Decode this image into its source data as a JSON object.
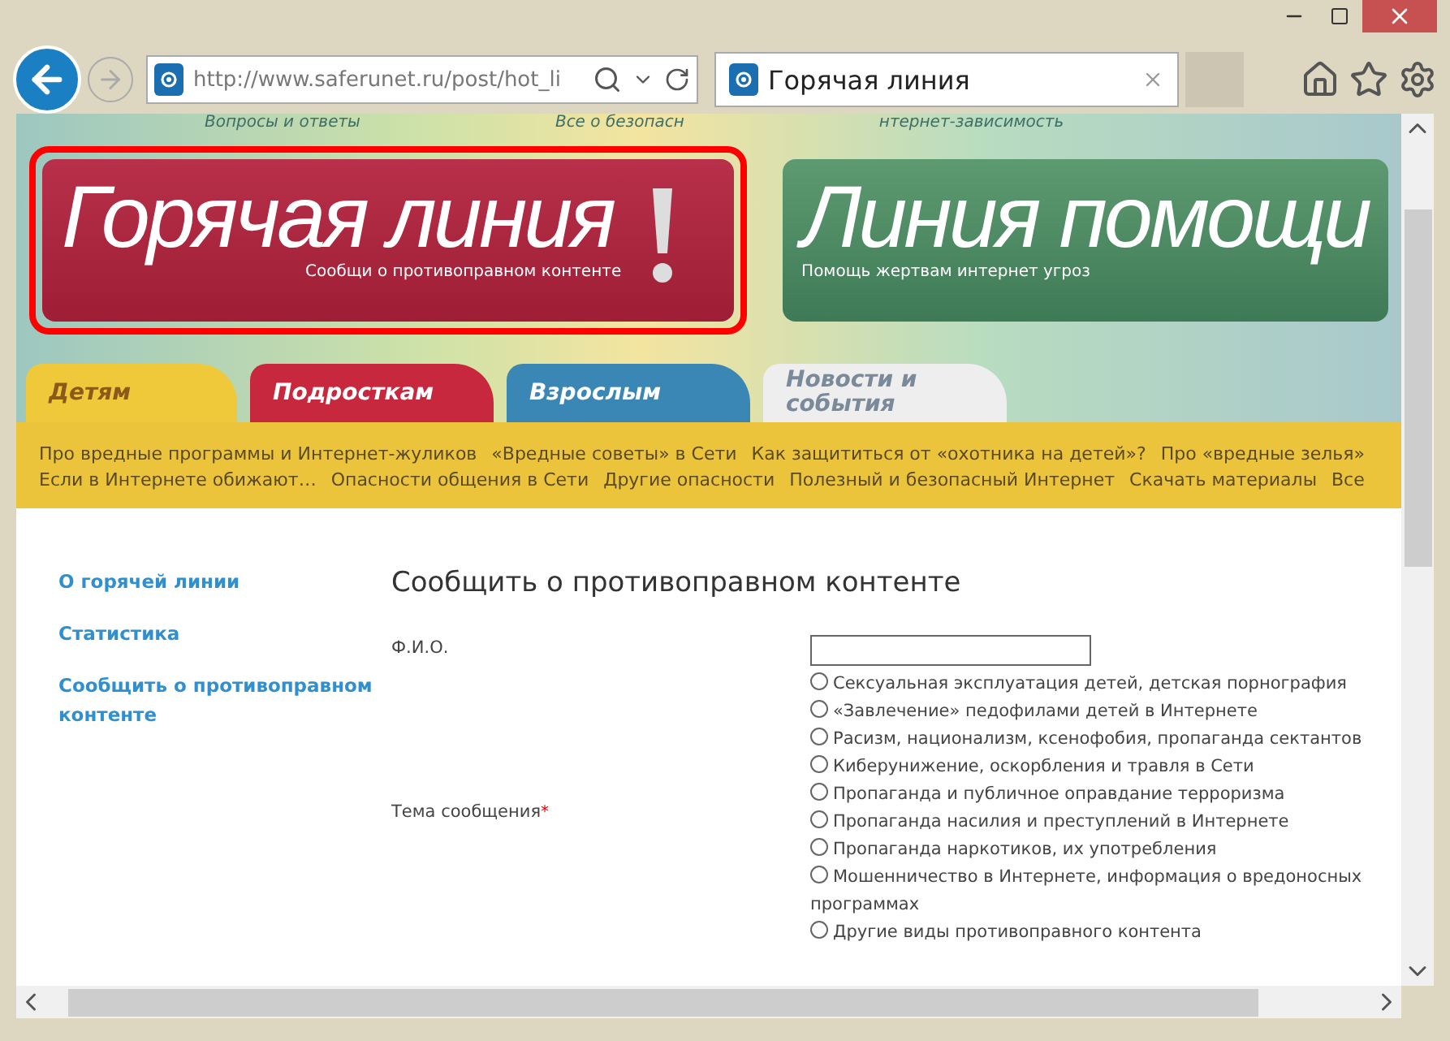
{
  "browser": {
    "address": "http://www.saferunet.ru/post/hot_li",
    "tab": {
      "title": "Горячая линия",
      "selected": true
    }
  },
  "header_links": [
    "Вопросы и ответы",
    "Все о безопасн",
    "нтернет-зависимость"
  ],
  "banners": [
    {
      "kind": "hot",
      "title": "Горячая линия",
      "subtitle": "Сообщи о противоправном контенте",
      "selected": true
    },
    {
      "kind": "help",
      "title": "Линия помощи",
      "subtitle": "Помощь жертвам интернет угроз",
      "selected": false
    }
  ],
  "tabs": [
    {
      "label": "Детям",
      "color": "#f0c93a",
      "selected": true
    },
    {
      "label": "Подросткам",
      "color": "#c8283e",
      "selected": false
    },
    {
      "label": "Взрослым",
      "color": "#3a86b4",
      "selected": false
    },
    {
      "label": "Новости и события",
      "color": "#eeeeee",
      "selected": false
    }
  ],
  "nav_links": [
    "Про вредные программы и Интернет-жуликов",
    "«Вредные советы» в Сети",
    "Как защититься от «охотника на детей»?",
    "Про «вредные зелья»",
    "Если в Интернете обижают…",
    "Опасности общения в Сети",
    "Другие опасности",
    "Полезный и безопасный Интернет",
    "Скачать материалы",
    "Все"
  ],
  "sidebar": {
    "items": [
      "О горячей линии",
      "Статистика",
      "Сообщить о противоправном контенте"
    ]
  },
  "form": {
    "title": "Сообщить о противоправном контенте",
    "name_field": {
      "label": "Ф.И.О."
    },
    "topic": {
      "label": "Тема сообщения",
      "required": true,
      "required_mark": "*",
      "options": [
        {
          "label": "Сексуальная эксплуатация детей, детская порнография",
          "selected": false
        },
        {
          "label": "«Завлечение» педофилами детей в Интернете",
          "selected": false
        },
        {
          "label": "Расизм, национализм, ксенофобия, пропаганда сектантов",
          "selected": false
        },
        {
          "label": "Киберунижение, оскорбления и травля в Сети",
          "selected": false
        },
        {
          "label": "Пропаганда и публичное оправдание терроризма",
          "selected": false
        },
        {
          "label": "Пропаганда насилия и преступлений в Интернете",
          "selected": false
        },
        {
          "label": "Пропаганда наркотиков, их употребления",
          "selected": false
        },
        {
          "label": "Мошенничество в Интернете, информация о вредоносных программах",
          "selected": false
        },
        {
          "label": "Другие виды противоправного контента",
          "selected": false
        }
      ]
    }
  }
}
